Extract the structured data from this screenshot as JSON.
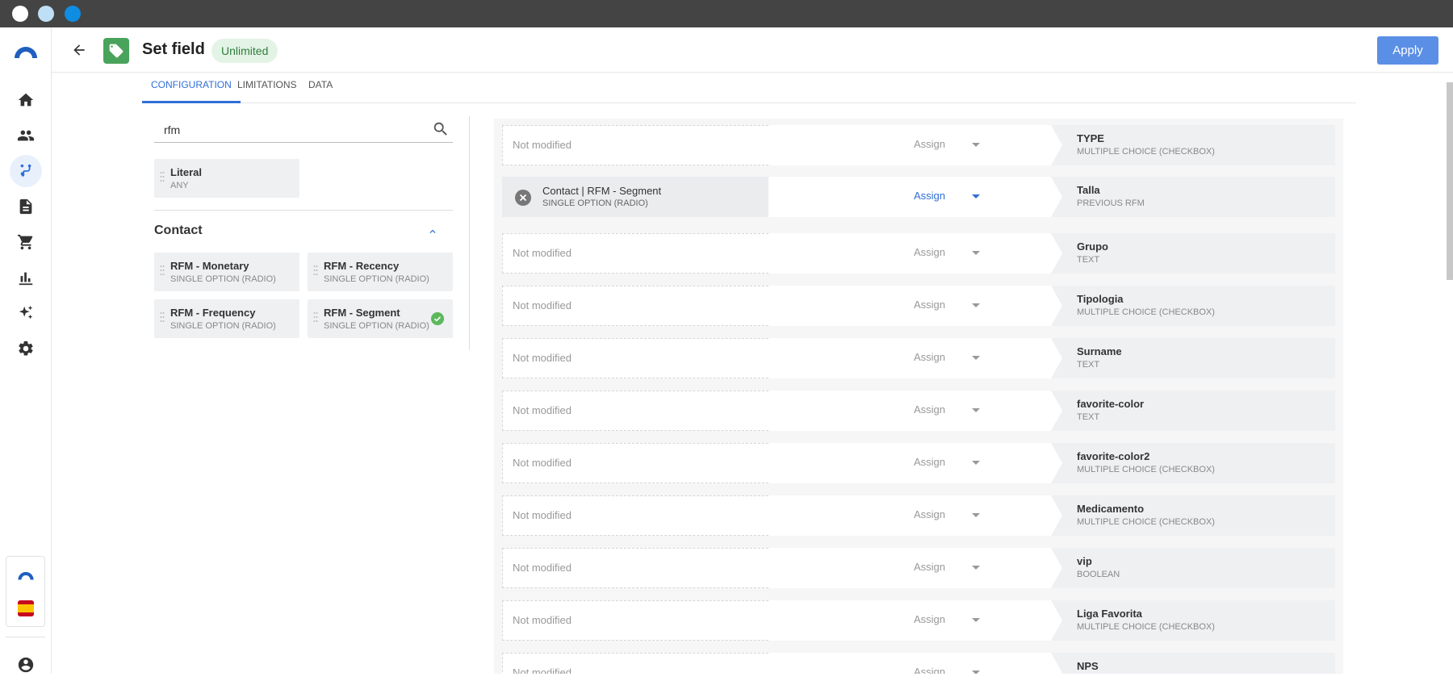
{
  "header": {
    "title": "Set field",
    "badge": "Unlimited",
    "apply_label": "Apply"
  },
  "tabs": [
    {
      "label": "CONFIGURATION",
      "active": true
    },
    {
      "label": "LIMITATIONS",
      "active": false
    },
    {
      "label": "DATA",
      "active": false
    }
  ],
  "search": {
    "value": "rfm"
  },
  "literal_chip": {
    "title": "Literal",
    "subtitle": "ANY"
  },
  "contact_section": {
    "title": "Contact",
    "chips": [
      {
        "title": "RFM - Monetary",
        "subtitle": "SINGLE OPTION (RADIO)",
        "selected": false
      },
      {
        "title": "RFM - Recency",
        "subtitle": "SINGLE OPTION (RADIO)",
        "selected": false
      },
      {
        "title": "RFM - Frequency",
        "subtitle": "SINGLE OPTION (RADIO)",
        "selected": false
      },
      {
        "title": "RFM - Segment",
        "subtitle": "SINGLE OPTION (RADIO)",
        "selected": true
      }
    ]
  },
  "rows": [
    {
      "source": "Not modified",
      "source_sub": "",
      "filled": false,
      "assign": "Assign",
      "target": "TYPE",
      "target_type": "MULTIPLE CHOICE (CHECKBOX)"
    },
    {
      "source": "Contact | RFM - Segment",
      "source_sub": "SINGLE OPTION (RADIO)",
      "filled": true,
      "assign": "Assign",
      "target": "Talla",
      "target_type": "PREVIOUS RFM"
    },
    {
      "source": "Not modified",
      "source_sub": "",
      "filled": false,
      "assign": "Assign",
      "target": "Grupo",
      "target_type": "TEXT"
    },
    {
      "source": "Not modified",
      "source_sub": "",
      "filled": false,
      "assign": "Assign",
      "target": "Tipologia",
      "target_type": "MULTIPLE CHOICE (CHECKBOX)"
    },
    {
      "source": "Not modified",
      "source_sub": "",
      "filled": false,
      "assign": "Assign",
      "target": "Surname",
      "target_type": "TEXT"
    },
    {
      "source": "Not modified",
      "source_sub": "",
      "filled": false,
      "assign": "Assign",
      "target": "favorite-color",
      "target_type": "TEXT"
    },
    {
      "source": "Not modified",
      "source_sub": "",
      "filled": false,
      "assign": "Assign",
      "target": "favorite-color2",
      "target_type": "MULTIPLE CHOICE (CHECKBOX)"
    },
    {
      "source": "Not modified",
      "source_sub": "",
      "filled": false,
      "assign": "Assign",
      "target": "Medicamento",
      "target_type": "MULTIPLE CHOICE (CHECKBOX)"
    },
    {
      "source": "Not modified",
      "source_sub": "",
      "filled": false,
      "assign": "Assign",
      "target": "vip",
      "target_type": "BOOLEAN"
    },
    {
      "source": "Not modified",
      "source_sub": "",
      "filled": false,
      "assign": "Assign",
      "target": "Liga Favorita",
      "target_type": "MULTIPLE CHOICE (CHECKBOX)"
    },
    {
      "source": "Not modified",
      "source_sub": "",
      "filled": false,
      "assign": "Assign",
      "target": "NPS",
      "target_type": ""
    }
  ],
  "nav": {
    "items": [
      "home-icon",
      "people-icon",
      "flow-icon",
      "document-icon",
      "cart-icon",
      "chart-icon",
      "sparkle-icon",
      "gear-icon"
    ],
    "active": "flow-icon"
  },
  "colors": {
    "accent": "#2f6fd6",
    "apply": "#5b8fe6",
    "badge_bg": "#e3f4e6",
    "tag_green": "#4aa35b",
    "check_green": "#5cb85c"
  }
}
